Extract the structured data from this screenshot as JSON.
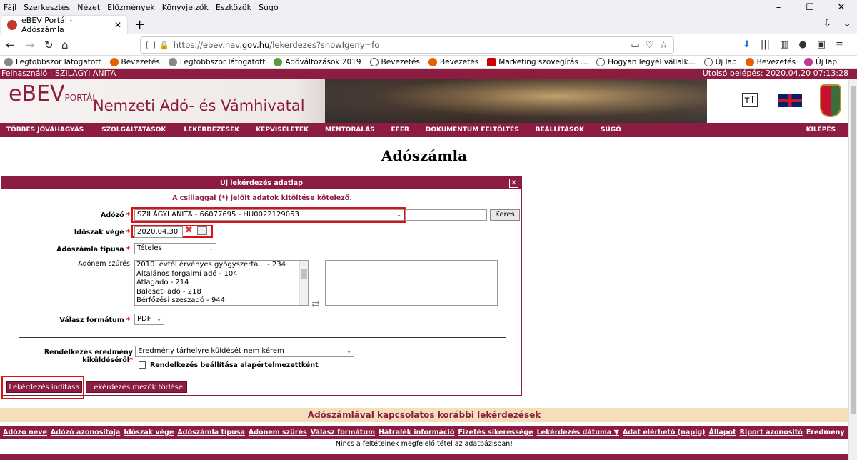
{
  "browser": {
    "menu": [
      "Fájl",
      "Szerkesztés",
      "Nézet",
      "Előzmények",
      "Könyvjelzők",
      "Eszközök",
      "Súgó"
    ],
    "tab_title": "eBEV Portál - Adószámla",
    "url_prefix": "https://ebev.nav.",
    "url_domain": "gov.hu",
    "url_suffix": "/lekerdezes?showIgeny=fo",
    "bookmarks": [
      "Legtöbbször látogatott",
      "Bevezetés",
      "Legtöbbször látogatott",
      "Adóváltozások 2019",
      "Bevezetés",
      "Bevezetés",
      "Marketing szövegírás ...",
      "Hogyan legyél vállalk...",
      "Új lap",
      "Bevezetés",
      "Új lap"
    ]
  },
  "portal": {
    "user": "Felhasználó : SZILÁGYI ANITA",
    "last_login": "Utolsó belépés: 2020.04.20 07:13:28",
    "logo_main": "eBEV",
    "logo_sub": "PORTÁL",
    "agency": "Nemzeti Adó- és Vámhivatal",
    "tt_label": "тT",
    "menu": [
      "TÖBBES JÓVÁHAGYÁS",
      "SZOLGÁLTATÁSOK",
      "LEKÉRDEZÉSEK",
      "KÉPVISELETEK",
      "MENTORÁLÁS",
      "EFER",
      "DOKUMENTUM FELTÖLTÉS",
      "BEÁLLÍTÁSOK",
      "SÚGÓ"
    ],
    "logout": "KILÉPÉS"
  },
  "page": {
    "title": "Adószámla"
  },
  "form": {
    "title": "Új lekérdezés adatlap",
    "required_note": "A csillaggal (*) jelölt adatok kitöltése kötelező.",
    "taxpayer_label": "Adózó",
    "taxpayer_value": "SZILÁGYI ANITA - 66077695 - HU0022129053",
    "search_button": "Keres",
    "period_end_label": "Időszak vége",
    "period_end_value": "2020.04.30",
    "account_type_label": "Adószámla típusa",
    "account_type_value": "Tételes",
    "tax_filter_label": "Adónem szűrés",
    "tax_types": [
      "2010. évtől érvényes gyógyszertá... - 234",
      "Általános forgalmi adó - 104",
      "Átlagadó - 214",
      "Baleseti adó - 218",
      "Bérfőzési szeszadó - 944"
    ],
    "response_format_label": "Válasz formátum",
    "response_format_value": "PDF",
    "delivery_label": "Rendelkezés eredmény kiküldéséről",
    "delivery_value": "Eredmény tárhelyre küldését nem kérem",
    "default_checkbox_label": "Rendelkezés beállítása alapértelmezettként",
    "start_button": "Lekérdezés indítása",
    "clear_button": "Lekérdezés mezők törlése",
    "star": "*"
  },
  "results": {
    "title": "Adószámlával kapcsolatos korábbi lekérdezések",
    "columns": [
      "Adózó neve",
      "Adózó azonosítója",
      "Időszak vége",
      "Adószámla típusa",
      "Adónem szűrés",
      "Válasz formátum",
      "Hátralék információ",
      "Fizetés sikeressége",
      "Lekérdezés dátuma ▼",
      "Adat elérhető (napig)",
      "Állapot",
      "Riport azonosító",
      "Eredmény"
    ],
    "empty_message": "Nincs a feltételnek megfelelő tétel az adatbázisban!"
  },
  "colors": {
    "brand": "#8c1d40",
    "highlight": "#e01010",
    "results_header": "#f5dfb8"
  }
}
